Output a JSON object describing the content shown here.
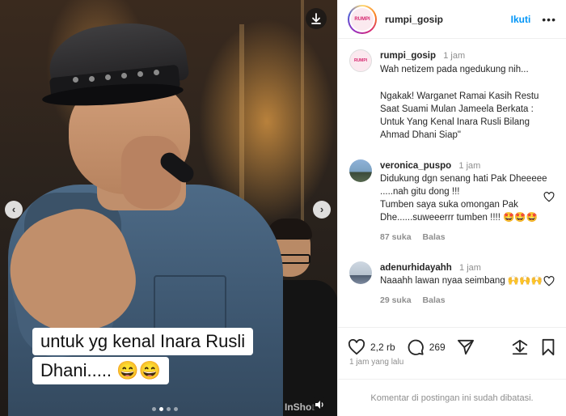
{
  "media": {
    "caption_line1": "untuk yg kenal Inara Rusli",
    "caption_line2": "Dhani..... 😄😄",
    "watermark": "InShot",
    "prev_arrow": "‹",
    "next_arrow": "›",
    "slide_count": 4,
    "active_slide": 2
  },
  "header": {
    "avatar_text": "RUMPI GOSSIP",
    "username": "rumpi_gosip",
    "follow_label": "Ikuti",
    "more_icon": "•••"
  },
  "post_caption": {
    "username": "rumpi_gosip",
    "time": "1 jam",
    "avatar_text": "RUMPI GOSSIP",
    "line1": "Wah netizem pada ngedukung nih...",
    "body": "Ngakak! Warganet Ramai Kasih Restu Saat Suami Mulan Jameela Berkata : Untuk Yang Kenal Inara Rusli Bilang Ahmad Dhani Siap\""
  },
  "comments": [
    {
      "username": "veronica_puspo",
      "time": "1 jam",
      "line1": "Didukung dgn senang hati Pak Dheeeee .....nah gitu dong !!!",
      "line2": "Tumben saya suka omongan Pak Dhe......suweeerrr tumben !!!! 🤩🤩🤩",
      "likes": "87 suka",
      "reply": "Balas"
    },
    {
      "username": "adenurhidayahh",
      "time": "1 jam",
      "line1": "Naaahh lawan nyaa seimbang 🙌🙌🙌",
      "likes": "29 suka",
      "reply": "Balas"
    }
  ],
  "actions": {
    "likes": "2,2 rb",
    "comments": "269",
    "posted": "1 jam yang lalu"
  },
  "footer": {
    "comments_disabled": "Komentar di postingan ini sudah dibatasi."
  }
}
